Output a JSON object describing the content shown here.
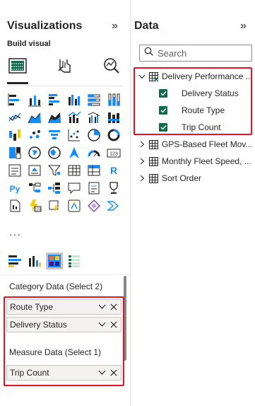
{
  "visualizations": {
    "title": "Visualizations",
    "collapse_icon": "»",
    "build_label": "Build visual",
    "more_label": "···",
    "wells": [
      {
        "label": "Category Data (Select 2)",
        "fields": [
          "Route Type",
          "Delivery Status"
        ]
      },
      {
        "label": "Measure Data (Select 1)",
        "fields": [
          "Trip Count"
        ]
      }
    ]
  },
  "data": {
    "title": "Data",
    "collapse_icon": "»",
    "search_placeholder": "Search",
    "tables": [
      {
        "name": "Delivery Performance ...",
        "expanded": true,
        "fields": [
          "Delivery Status",
          "Route Type",
          "Trip Count"
        ]
      },
      {
        "name": "GPS-Based Fleet Mov...",
        "expanded": false
      },
      {
        "name": "Monthly Fleet Speed, ...",
        "expanded": false
      },
      {
        "name": "Sort Order",
        "expanded": false
      }
    ]
  },
  "colors": {
    "accent_red": "#e81123",
    "check_green": "#0f6b4b",
    "icon_blue": "#118dff",
    "icon_dark": "#252423"
  }
}
